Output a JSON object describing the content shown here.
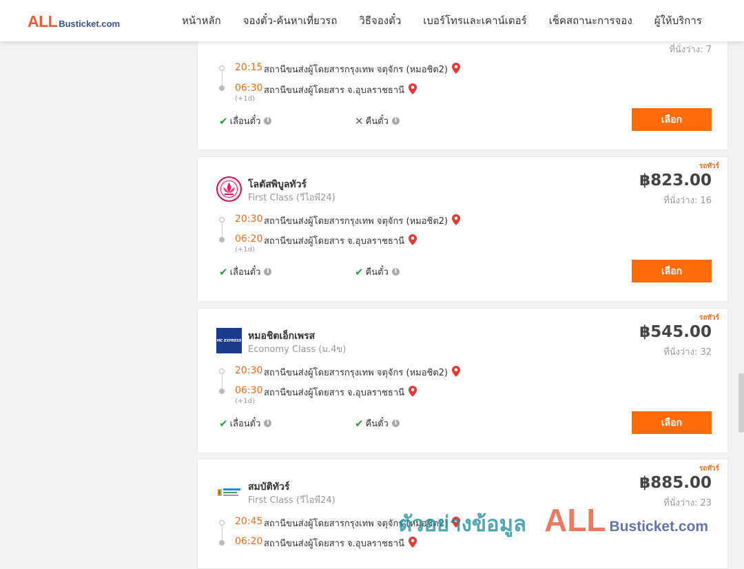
{
  "header": {
    "logo_all": "ALL",
    "logo_rest": "Busticket.com",
    "nav": [
      "หน้าหลัก",
      "จองตั๋ว-ค้นหาเที่ยวรถ",
      "วิธีจองตั๋ว",
      "เบอร์โทรและเคาน์เตอร์",
      "เช็คสถานะการจอง",
      "ผู้ให้บริการ"
    ]
  },
  "colors": {
    "accent": "#ff6b08",
    "time": "#f26a1b",
    "ok": "#2d9c3c",
    "brand_red": "#ec5a3a",
    "brand_blue": "#3a4f8c"
  },
  "cards": [
    {
      "seats": "ที่นั่งว่าง: 7",
      "depart_time": "20:15",
      "depart_station": "สถานีขนส่งผู้โดยสารกรุงเทพ จตุจักร (หมอชิต2)",
      "arrive_time": "06:30",
      "arrive_station": "สถานีขนส่งผู้โดยสาร จ.อุบลราชธานี",
      "plus_day": "(+1d)",
      "change_label": "เลื่อนตั๋ว",
      "change_allowed": true,
      "refund_label": "คืนตั๋ว",
      "refund_allowed": false,
      "button": "เลือก"
    },
    {
      "tag": "รถทัวร์",
      "operator": "โลตัสพิบูลทัวร์",
      "bus_class": "First Class (วีไอพี24)",
      "logo_icon": "lotus-logo-icon",
      "price": "฿823.00",
      "seats": "ที่นั่งว่าง: 16",
      "depart_time": "20:30",
      "depart_station": "สถานีขนส่งผู้โดยสารกรุงเทพ จตุจักร (หมอชิต2)",
      "arrive_time": "06:20",
      "arrive_station": "สถานีขนส่งผู้โดยสาร จ.อุบลราชธานี",
      "plus_day": "(+1d)",
      "change_label": "เลื่อนตั๋ว",
      "change_allowed": true,
      "refund_label": "คืนตั๋ว",
      "refund_allowed": true,
      "button": "เลือก"
    },
    {
      "tag": "รถทัวร์",
      "operator": "หมอชิตเอ็กเพรส",
      "bus_class": "Economy Class (ม.4ข)",
      "logo_icon": "mochit-express-logo-icon",
      "logo_text": "MC EXPRESS",
      "price": "฿545.00",
      "seats": "ที่นั่งว่าง: 32",
      "depart_time": "20:30",
      "depart_station": "สถานีขนส่งผู้โดยสารกรุงเทพ จตุจักร (หมอชิต2)",
      "arrive_time": "06:30",
      "arrive_station": "สถานีขนส่งผู้โดยสาร จ.อุบลราชธานี",
      "plus_day": "(+1d)",
      "change_label": "เลื่อนตั๋ว",
      "change_allowed": true,
      "refund_label": "คืนตั๋ว",
      "refund_allowed": true,
      "button": "เลือก"
    },
    {
      "tag": "รถทัวร์",
      "operator": "สมบัติทัวร์",
      "bus_class": "First Class (วีไอพี24)",
      "logo_icon": "sombat-tour-logo-icon",
      "price": "฿885.00",
      "seats": "ที่นั่งว่าง: 23",
      "depart_time": "20:45",
      "depart_station": "สถานีขนส่งผู้โดยสารกรุงเทพ จตุจักร (หมอชิต2)",
      "arrive_time": "06:20",
      "arrive_station": "สถานีขนส่งผู้โดยสาร จ.อุบลราชธานี"
    }
  ],
  "watermark": {
    "thai": "ตัวอย่างข้อมูล",
    "all": "ALL",
    "rest": "Busticket.com"
  }
}
